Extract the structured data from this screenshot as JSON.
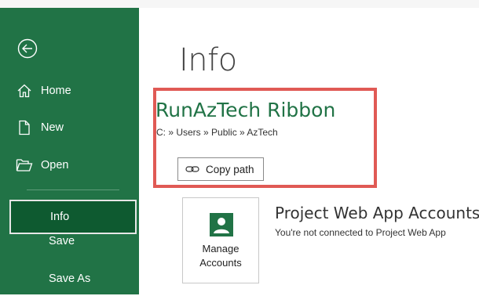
{
  "sidebar": {
    "items": [
      {
        "label": "Home",
        "icon": "home-icon"
      },
      {
        "label": "New",
        "icon": "new-document-icon"
      },
      {
        "label": "Open",
        "icon": "open-folder-icon"
      },
      {
        "label": "Info",
        "selected": true
      },
      {
        "label": "Save"
      },
      {
        "label": "Save As"
      }
    ],
    "back_icon": "back-arrow-icon"
  },
  "main": {
    "title": "Info",
    "document": {
      "name": "RunAzTech Ribbon",
      "path": "C: » Users » Public » AzTech",
      "copy_path_label": "Copy path"
    },
    "pwa": {
      "manage_label_line1": "Manage",
      "manage_label_line2": "Accounts",
      "title": "Project Web App Accounts",
      "description": "You're not connected to Project Web App"
    }
  },
  "colors": {
    "sidebar": "#217346",
    "selected": "#0e5a30",
    "doc_name": "#217346",
    "highlight": "#e05a55"
  }
}
